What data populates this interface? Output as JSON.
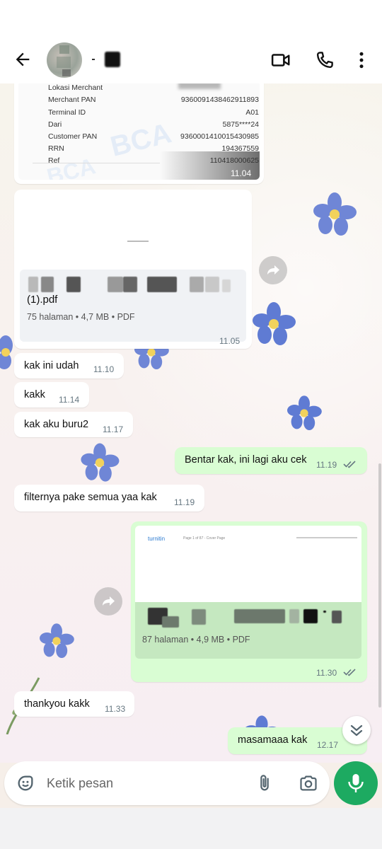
{
  "header": {
    "back_icon": "arrow-left-icon",
    "video_icon": "video-camera-icon",
    "call_icon": "phone-icon",
    "menu_icon": "more-vertical-icon"
  },
  "receipt": {
    "rows": [
      {
        "label": "Lokasi Merchant",
        "value": ""
      },
      {
        "label": "Merchant PAN",
        "value": "9360091438462911893"
      },
      {
        "label": "Terminal ID",
        "value": "A01"
      },
      {
        "label": "Dari",
        "value": "5875****24"
      },
      {
        "label": "Customer PAN",
        "value": "9360001410015430985"
      },
      {
        "label": "RRN",
        "value": "194367559"
      },
      {
        "label": "Ref",
        "value": "110418000625"
      }
    ],
    "time": "11.04",
    "watermark": "BCA"
  },
  "doc1": {
    "name": "(1).pdf",
    "meta": "75 halaman • 4,7 MB • PDF",
    "time": "11.05"
  },
  "messages": [
    {
      "text": "kak ini udah",
      "time": "11.10"
    },
    {
      "text": "kakk",
      "time": "11.14"
    },
    {
      "text": "kak aku buru2",
      "time": "11.17"
    },
    {
      "text": "Bentar kak, ini lagi aku cek",
      "time": "11.19"
    },
    {
      "text": "filternya pake semua yaa kak",
      "time": "11.19"
    },
    {
      "text": "thankyou kakk",
      "time": "11.33"
    },
    {
      "text": "masamaaa kak",
      "time": "12.17"
    }
  ],
  "doc2": {
    "preview_brand": "turnitin",
    "preview_header": "Page 1 of 87 - Cover Page",
    "meta": "87 halaman • 4,9 MB • PDF",
    "time": "11.30"
  },
  "composer": {
    "placeholder": "Ketik pesan",
    "emoji_icon": "sticker-emoji-icon",
    "attach_icon": "paperclip-icon",
    "camera_icon": "camera-icon",
    "mic_icon": "microphone-icon"
  },
  "colors": {
    "incoming": "#ffffff",
    "outgoing": "#d9fdd3",
    "accent": "#1daa61",
    "read_ticks": "#53bdeb"
  }
}
